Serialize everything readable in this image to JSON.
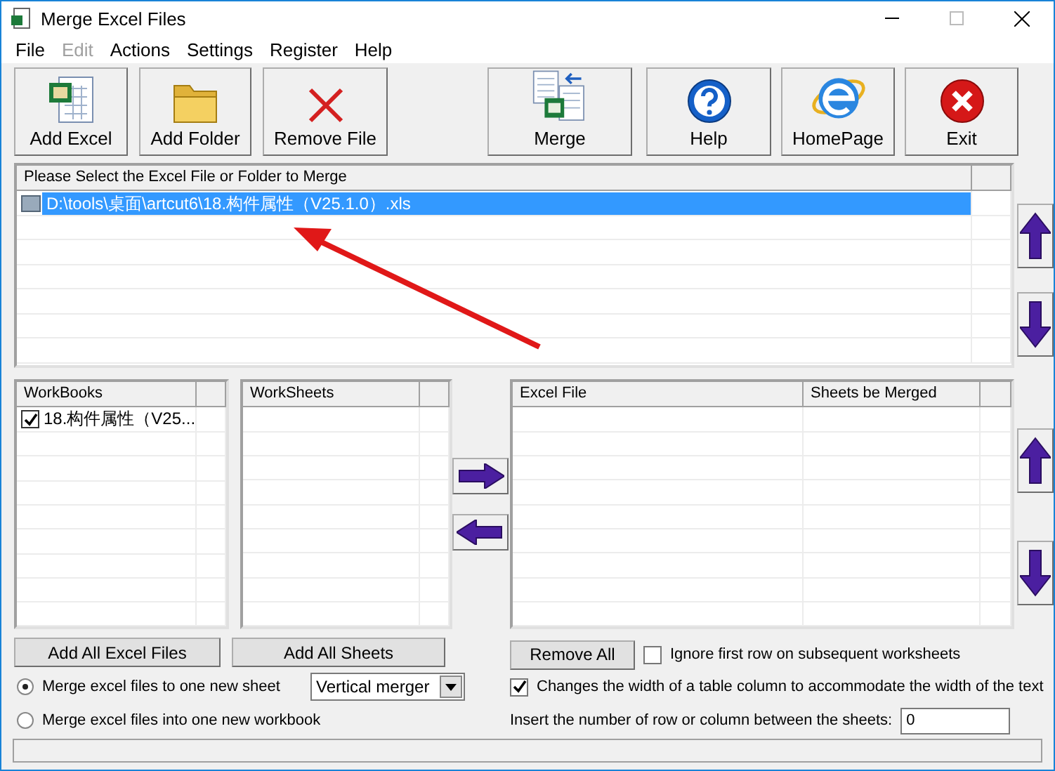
{
  "window": {
    "title": "Merge Excel Files"
  },
  "menu": [
    {
      "label": "File",
      "disabled": false
    },
    {
      "label": "Edit",
      "disabled": true
    },
    {
      "label": "Actions",
      "disabled": false
    },
    {
      "label": "Settings",
      "disabled": false
    },
    {
      "label": "Register",
      "disabled": false
    },
    {
      "label": "Help",
      "disabled": false
    }
  ],
  "toolbar": [
    {
      "label": "Add Excel",
      "kind": "excel"
    },
    {
      "label": "Add Folder",
      "kind": "folder"
    },
    {
      "label": "Remove File",
      "kind": "remove"
    },
    {
      "label": "Merge",
      "kind": "merge"
    },
    {
      "label": "Help",
      "kind": "help"
    },
    {
      "label": "HomePage",
      "kind": "web"
    },
    {
      "label": "Exit",
      "kind": "exit"
    }
  ],
  "file_list": {
    "column": "Please Select the Excel File or Folder to Merge",
    "rows": [
      {
        "path": "D:\\tools\\桌面\\artcut6\\18.构件属性（V25.1.0）.xls",
        "selected": true
      }
    ]
  },
  "workbooks": {
    "column": "WorkBooks",
    "items": [
      {
        "label": "18.构件属性（V25...",
        "checked": true
      }
    ]
  },
  "worksheets": {
    "column": "WorkSheets"
  },
  "merge_list": {
    "columns": [
      "Excel File",
      "Sheets be Merged"
    ]
  },
  "buttons": {
    "add_all_files": "Add All Excel Files",
    "add_all_sheets": "Add All Sheets",
    "remove_all": "Remove All"
  },
  "modes": [
    {
      "label": "Merge excel files to one new sheet",
      "selected": true
    },
    {
      "label": "Merge excel files into one new workbook",
      "selected": false
    }
  ],
  "merger": {
    "value": "Vertical merger"
  },
  "ignore_first_row": {
    "label": "Ignore first row on subsequent worksheets",
    "checked": false
  },
  "auto_width": {
    "label": "Changes the width of a table column to accommodate the width of the text",
    "checked": true
  },
  "spacing": {
    "label": "Insert the number of row or column between the sheets:",
    "value": "0"
  }
}
